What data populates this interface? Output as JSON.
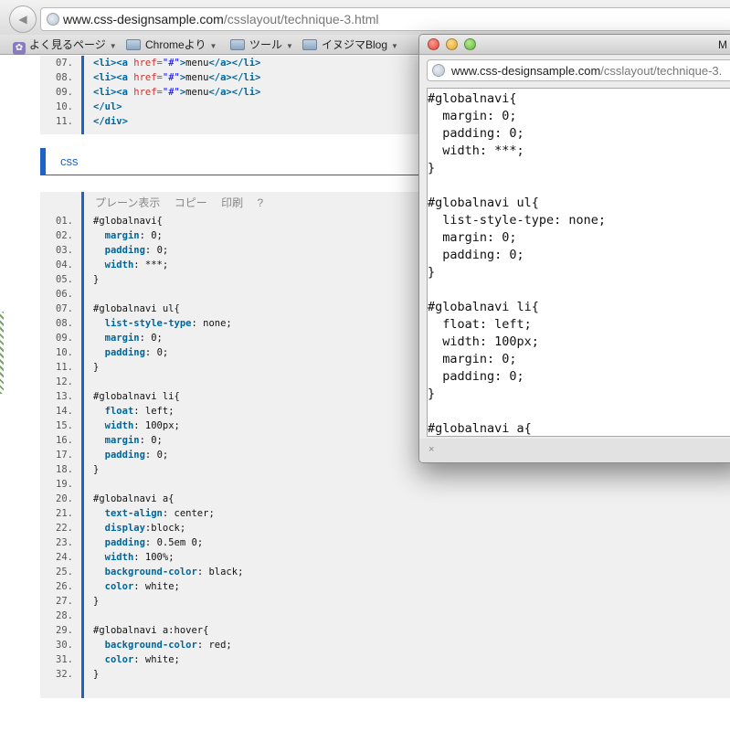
{
  "browser": {
    "url_host": "www.css-designsample.com",
    "url_path": "/csslayout/technique-3.html"
  },
  "bookmarks": [
    {
      "label": "よく見るページ",
      "icon": "gear-icon"
    },
    {
      "label": "Chromeより",
      "icon": "folder-icon"
    },
    {
      "label": "ツール",
      "icon": "folder-icon"
    },
    {
      "label": "イヌジマBlog",
      "icon": "folder-icon"
    }
  ],
  "html_code": {
    "lines": [
      {
        "n": "07.",
        "parts": [
          [
            "t",
            "<li>"
          ],
          [
            "t",
            "<a "
          ],
          [
            "a",
            "href="
          ],
          [
            "s",
            "\"#\""
          ],
          [
            "t",
            ">"
          ],
          [
            "p",
            "menu"
          ],
          [
            "t",
            "</a>"
          ],
          [
            "t",
            "</li>"
          ]
        ]
      },
      {
        "n": "08.",
        "parts": [
          [
            "t",
            "<li>"
          ],
          [
            "t",
            "<a "
          ],
          [
            "a",
            "href="
          ],
          [
            "s",
            "\"#\""
          ],
          [
            "t",
            ">"
          ],
          [
            "p",
            "menu"
          ],
          [
            "t",
            "</a>"
          ],
          [
            "t",
            "</li>"
          ]
        ]
      },
      {
        "n": "09.",
        "parts": [
          [
            "t",
            "<li>"
          ],
          [
            "t",
            "<a "
          ],
          [
            "a",
            "href="
          ],
          [
            "s",
            "\"#\""
          ],
          [
            "t",
            ">"
          ],
          [
            "p",
            "menu"
          ],
          [
            "t",
            "</a>"
          ],
          [
            "t",
            "</li>"
          ]
        ]
      },
      {
        "n": "10.",
        "parts": [
          [
            "t",
            "</ul>"
          ]
        ]
      },
      {
        "n": "11.",
        "parts": [
          [
            "t",
            "</div>"
          ]
        ]
      }
    ]
  },
  "css_section": {
    "heading": "css",
    "toolbar": [
      "プレーン表示",
      "コピー",
      "印刷",
      "?"
    ]
  },
  "css_code": {
    "lines": [
      {
        "n": "01.",
        "parts": [
          [
            "p",
            "#globalnavi{"
          ]
        ]
      },
      {
        "n": "02.",
        "parts": [
          [
            "p",
            "  "
          ],
          [
            "k",
            "margin"
          ],
          [
            "p",
            ": 0;"
          ]
        ]
      },
      {
        "n": "03.",
        "parts": [
          [
            "p",
            "  "
          ],
          [
            "k",
            "padding"
          ],
          [
            "p",
            ": 0;"
          ]
        ]
      },
      {
        "n": "04.",
        "parts": [
          [
            "p",
            "  "
          ],
          [
            "k",
            "width"
          ],
          [
            "p",
            ": ***;"
          ]
        ]
      },
      {
        "n": "05.",
        "parts": [
          [
            "p",
            "}"
          ]
        ]
      },
      {
        "n": "06.",
        "parts": [
          [
            "p",
            ""
          ]
        ]
      },
      {
        "n": "07.",
        "parts": [
          [
            "p",
            "#globalnavi ul{"
          ]
        ]
      },
      {
        "n": "08.",
        "parts": [
          [
            "p",
            "  "
          ],
          [
            "k",
            "list-style-type"
          ],
          [
            "p",
            ": none;"
          ]
        ]
      },
      {
        "n": "09.",
        "parts": [
          [
            "p",
            "  "
          ],
          [
            "k",
            "margin"
          ],
          [
            "p",
            ": 0;"
          ]
        ]
      },
      {
        "n": "10.",
        "parts": [
          [
            "p",
            "  "
          ],
          [
            "k",
            "padding"
          ],
          [
            "p",
            ": 0;"
          ]
        ]
      },
      {
        "n": "11.",
        "parts": [
          [
            "p",
            "}"
          ]
        ]
      },
      {
        "n": "12.",
        "parts": [
          [
            "p",
            ""
          ]
        ]
      },
      {
        "n": "13.",
        "parts": [
          [
            "p",
            "#globalnavi li{"
          ]
        ]
      },
      {
        "n": "14.",
        "parts": [
          [
            "p",
            "  "
          ],
          [
            "k",
            "float"
          ],
          [
            "p",
            ": left;"
          ]
        ]
      },
      {
        "n": "15.",
        "parts": [
          [
            "p",
            "  "
          ],
          [
            "k",
            "width"
          ],
          [
            "p",
            ": 100px;"
          ]
        ]
      },
      {
        "n": "16.",
        "parts": [
          [
            "p",
            "  "
          ],
          [
            "k",
            "margin"
          ],
          [
            "p",
            ": 0;"
          ]
        ]
      },
      {
        "n": "17.",
        "parts": [
          [
            "p",
            "  "
          ],
          [
            "k",
            "padding"
          ],
          [
            "p",
            ": 0;"
          ]
        ]
      },
      {
        "n": "18.",
        "parts": [
          [
            "p",
            "}"
          ]
        ]
      },
      {
        "n": "19.",
        "parts": [
          [
            "p",
            ""
          ]
        ]
      },
      {
        "n": "20.",
        "parts": [
          [
            "p",
            "#globalnavi a{"
          ]
        ]
      },
      {
        "n": "21.",
        "parts": [
          [
            "p",
            "  "
          ],
          [
            "k",
            "text-align"
          ],
          [
            "p",
            ": center;"
          ]
        ]
      },
      {
        "n": "22.",
        "parts": [
          [
            "p",
            "  "
          ],
          [
            "k",
            "display"
          ],
          [
            "p",
            ":block;"
          ]
        ]
      },
      {
        "n": "23.",
        "parts": [
          [
            "p",
            "  "
          ],
          [
            "k",
            "padding"
          ],
          [
            "p",
            ": 0.5em 0;"
          ]
        ]
      },
      {
        "n": "24.",
        "parts": [
          [
            "p",
            "  "
          ],
          [
            "k",
            "width"
          ],
          [
            "p",
            ": 100%;"
          ]
        ]
      },
      {
        "n": "25.",
        "parts": [
          [
            "p",
            "  "
          ],
          [
            "k",
            "background-color"
          ],
          [
            "p",
            ": black;"
          ]
        ]
      },
      {
        "n": "26.",
        "parts": [
          [
            "p",
            "  "
          ],
          [
            "k",
            "color"
          ],
          [
            "p",
            ": white;"
          ]
        ]
      },
      {
        "n": "27.",
        "parts": [
          [
            "p",
            "}"
          ]
        ]
      },
      {
        "n": "28.",
        "parts": [
          [
            "p",
            ""
          ]
        ]
      },
      {
        "n": "29.",
        "parts": [
          [
            "p",
            "#globalnavi a:hover{"
          ]
        ]
      },
      {
        "n": "30.",
        "parts": [
          [
            "p",
            "  "
          ],
          [
            "k",
            "background-color"
          ],
          [
            "p",
            ": red;"
          ]
        ]
      },
      {
        "n": "31.",
        "parts": [
          [
            "p",
            "  "
          ],
          [
            "k",
            "color"
          ],
          [
            "p",
            ": white;"
          ]
        ]
      },
      {
        "n": "32.",
        "parts": [
          [
            "p",
            "}"
          ]
        ]
      }
    ]
  },
  "popup": {
    "title": "M",
    "url_host": "www.css-designsample.com",
    "url_path": "/csslayout/technique-3.",
    "lines": [
      "#globalnavi{",
      "  margin: 0;",
      "  padding: 0;",
      "  width: ***;",
      "}",
      "",
      "#globalnavi ul{",
      "  list-style-type: none;",
      "  margin: 0;",
      "  padding: 0;",
      "}",
      "",
      "#globalnavi li{",
      "  float: left;",
      "  width: 100px;",
      "  margin: 0;",
      "  padding: 0;",
      "}",
      "",
      "#globalnavi a{"
    ],
    "status_close": "×"
  },
  "colors": {
    "accent_blue": "#1d63c7",
    "code_background": "#f0f0f0",
    "keyword": "#006699",
    "attribute": "#cc3333",
    "string": "#0000ff"
  }
}
